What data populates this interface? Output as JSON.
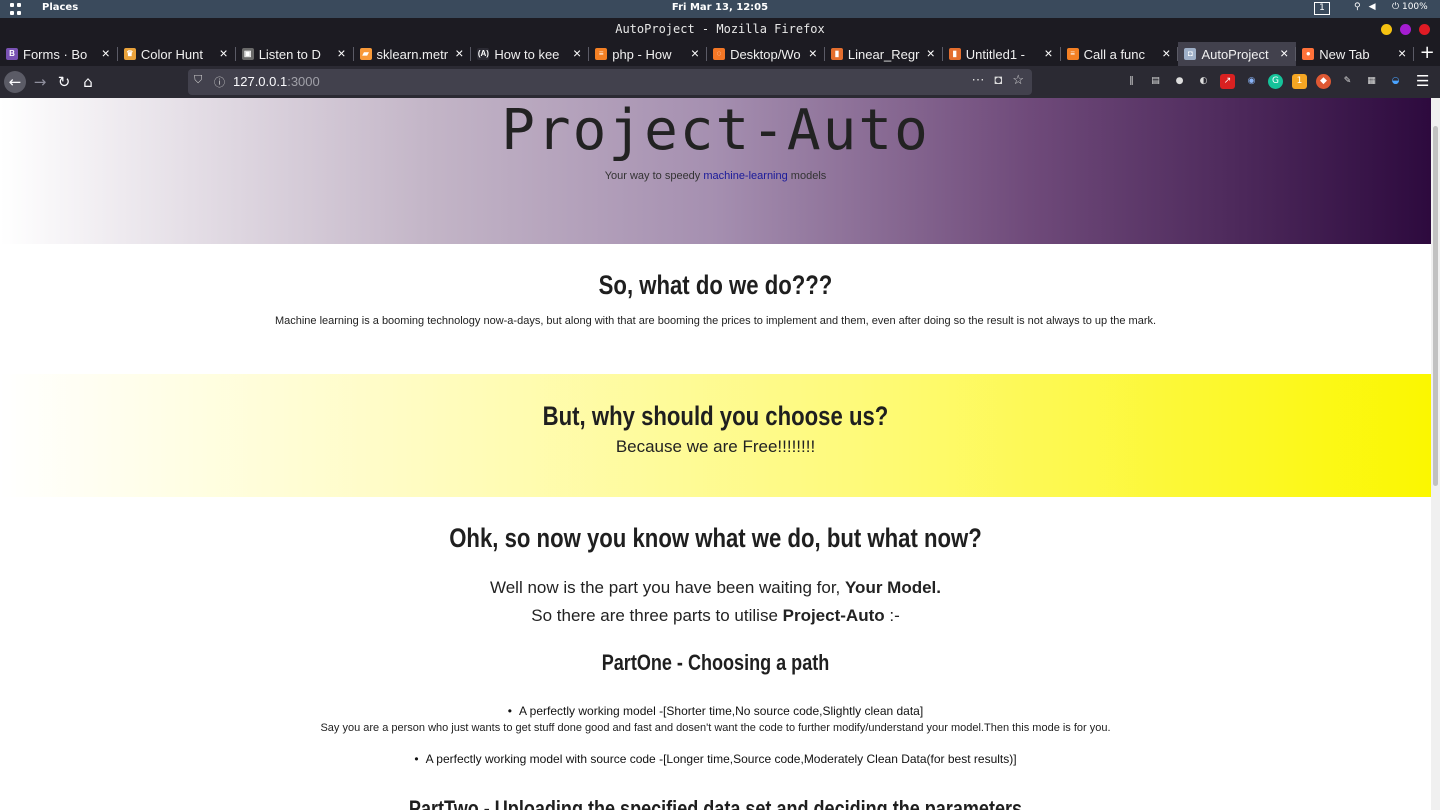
{
  "system": {
    "activities_label": "Places",
    "clock": "Fri Mar 13, 12:05",
    "workspace": "1",
    "battery": "100%"
  },
  "window": {
    "title": "AutoProject - Mozilla Firefox"
  },
  "tabs": [
    {
      "label": "Forms · Bo",
      "icon": "bootstrap-icon",
      "color": "#7952b3",
      "glyph": "B"
    },
    {
      "label": "Color Hunt",
      "icon": "color-hunt-icon",
      "color": "#e9a23b",
      "glyph": "♛"
    },
    {
      "label": "Listen to D",
      "icon": "listen-icon",
      "color": "#6a6a6a",
      "glyph": "▣"
    },
    {
      "label": "sklearn.metr",
      "icon": "sklearn-icon",
      "color": "#f89939",
      "glyph": "▰"
    },
    {
      "label": "How to kee",
      "icon": "devto-icon",
      "color": "#2b2a33",
      "glyph": "(A)"
    },
    {
      "label": "php - How",
      "icon": "stackoverflow-icon",
      "color": "#f48024",
      "glyph": "≡"
    },
    {
      "label": "Desktop/Wo",
      "icon": "jupyter-icon",
      "color": "#f37726",
      "glyph": "◌"
    },
    {
      "label": "Linear_Regr",
      "icon": "notebook-icon",
      "color": "#e46e2e",
      "glyph": "▮"
    },
    {
      "label": "Untitled1 -",
      "icon": "notebook-icon",
      "color": "#e46e2e",
      "glyph": "▮"
    },
    {
      "label": "Call a func",
      "icon": "stackoverflow-icon",
      "color": "#f48024",
      "glyph": "≡"
    },
    {
      "label": "AutoProject",
      "icon": "page-icon",
      "color": "#9fb0c8",
      "glyph": "◘",
      "active": true
    },
    {
      "label": "New Tab",
      "icon": "firefox-icon",
      "color": "#ff7139",
      "glyph": "●"
    }
  ],
  "navbar": {
    "url_host": "127.0.0.1",
    "url_port": ":3000"
  },
  "page": {
    "hero_title": "Project-Auto",
    "hero_sub_before": "Your way to speedy ",
    "hero_sub_link": "machine-learning",
    "hero_sub_after": " models",
    "what_heading": "So, what do we do???",
    "what_text": "Machine learning is a booming technology now-a-days, but along with that are booming the prices to implement and them, even after doing so the result is not always to up the mark.",
    "why_heading": "But, why should you choose us?",
    "why_text": "Because we are Free!!!!!!!!",
    "now_heading": "Ohk, so now you know what we do, but what now?",
    "now_line1_before": "Well now is the part you have been waiting for, ",
    "now_line1_bold": "Your Model.",
    "now_line2_before": "So there are three parts to utilise ",
    "now_line2_bold": "Project-Auto",
    "now_line2_after": " :-",
    "part_one_heading": "PartOne - Choosing a path",
    "option1": "A perfectly working model -[Shorter time,No source code,Slightly clean data]",
    "option1_desc": "Say you are a person who just wants to get stuff done good and fast and dosen't want the code to further modify/understand your model.Then this mode is for you.",
    "option2": "A perfectly working model with source code -[Longer time,Source code,Moderately Clean Data(for best results)]",
    "part_two_heading": "PartTwo - Uploading the specified data set and deciding the parameters"
  }
}
